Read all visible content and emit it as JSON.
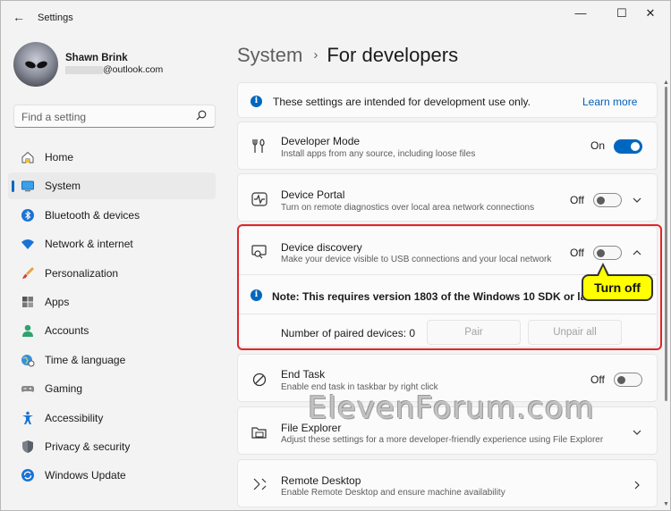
{
  "window": {
    "title": "Settings",
    "minimize": "—",
    "maximize": "☐",
    "close": "✕",
    "back": "←"
  },
  "user": {
    "name": "Shawn Brink",
    "email": "@outlook.com"
  },
  "search": {
    "placeholder": "Find a setting"
  },
  "nav": [
    {
      "label": "Home",
      "icon": "home-icon",
      "selected": false
    },
    {
      "label": "System",
      "icon": "system-icon",
      "selected": true
    },
    {
      "label": "Bluetooth & devices",
      "icon": "bluetooth-icon",
      "selected": false
    },
    {
      "label": "Network & internet",
      "icon": "wifi-icon",
      "selected": false
    },
    {
      "label": "Personalization",
      "icon": "brush-icon",
      "selected": false
    },
    {
      "label": "Apps",
      "icon": "apps-icon",
      "selected": false
    },
    {
      "label": "Accounts",
      "icon": "person-icon",
      "selected": false
    },
    {
      "label": "Time & language",
      "icon": "globe-icon",
      "selected": false
    },
    {
      "label": "Gaming",
      "icon": "gamepad-icon",
      "selected": false
    },
    {
      "label": "Accessibility",
      "icon": "accessibility-icon",
      "selected": false
    },
    {
      "label": "Privacy & security",
      "icon": "shield-icon",
      "selected": false
    },
    {
      "label": "Windows Update",
      "icon": "update-icon",
      "selected": false
    }
  ],
  "breadcrumb": {
    "parent": "System",
    "separator": "›",
    "current": "For developers"
  },
  "banner": {
    "text": "These settings are intended for development use only.",
    "link": "Learn more"
  },
  "developer_mode": {
    "title": "Developer Mode",
    "desc": "Install apps from any source, including loose files",
    "state": "On"
  },
  "device_portal": {
    "title": "Device Portal",
    "desc": "Turn on remote diagnostics over local area network connections",
    "state": "Off"
  },
  "device_discovery": {
    "title": "Device discovery",
    "desc": "Make your device visible to USB connections and your local network",
    "state": "Off",
    "note": "Note: This requires version 1803 of the Windows 10 SDK or later.",
    "paired_label": "Number of paired devices: 0",
    "pair_button": "Pair",
    "unpair_button": "Unpair all"
  },
  "end_task": {
    "title": "End Task",
    "desc": "Enable end task in taskbar by right click",
    "state": "Off"
  },
  "file_explorer": {
    "title": "File Explorer",
    "desc": "Adjust these settings for a more developer-friendly experience using File Explorer"
  },
  "remote_desktop": {
    "title": "Remote Desktop",
    "desc": "Enable Remote Desktop and ensure machine availability"
  },
  "annotation": {
    "callout": "Turn off"
  },
  "watermark": "ElevenForum.com",
  "colors": {
    "accent": "#0067c0",
    "highlight": "#e0262b",
    "callout": "#ffff00"
  }
}
